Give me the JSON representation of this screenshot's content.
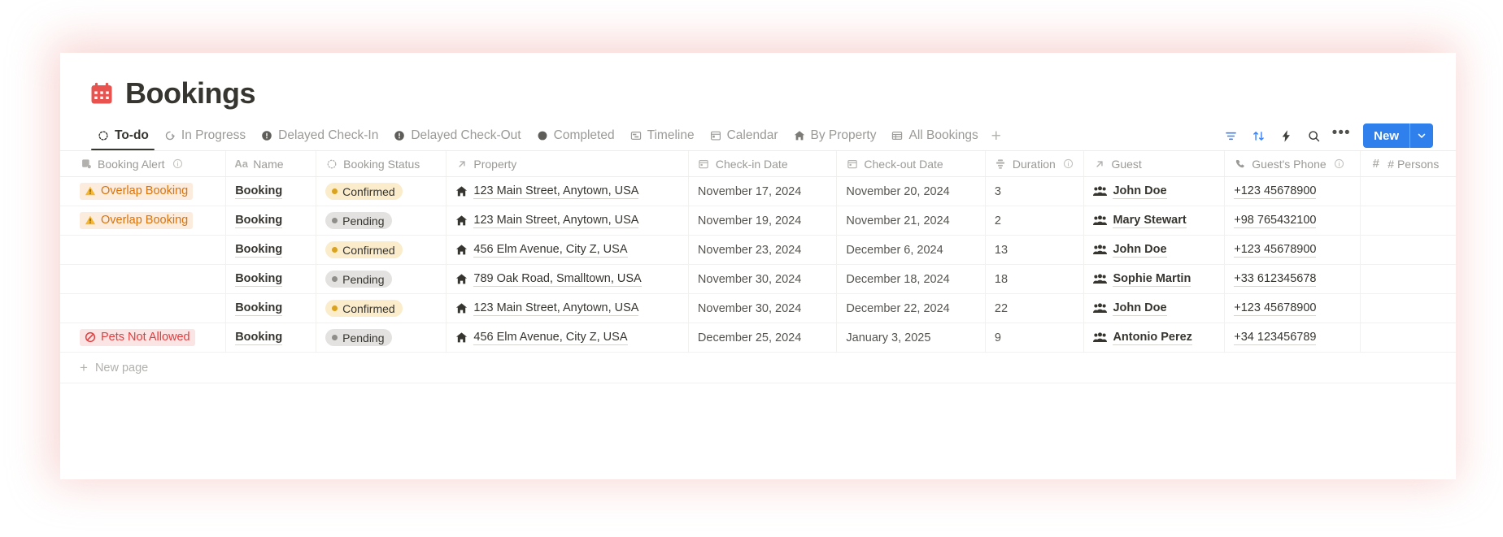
{
  "page": {
    "title": "Bookings",
    "icon": "calendar-icon"
  },
  "tabs": [
    {
      "label": "To-do",
      "icon": "dotted-circle-icon",
      "active": true
    },
    {
      "label": "In Progress",
      "icon": "progress-circle-icon",
      "active": false
    },
    {
      "label": "Delayed Check-In",
      "icon": "exclamation-circle-icon",
      "active": false
    },
    {
      "label": "Delayed Check-Out",
      "icon": "exclamation-circle-icon",
      "active": false
    },
    {
      "label": "Completed",
      "icon": "filled-circle-icon",
      "active": false
    },
    {
      "label": "Timeline",
      "icon": "timeline-icon",
      "active": false
    },
    {
      "label": "Calendar",
      "icon": "calendar-view-icon",
      "active": false
    },
    {
      "label": "By Property",
      "icon": "house-icon",
      "active": false
    },
    {
      "label": "All Bookings",
      "icon": "table-icon",
      "active": false
    }
  ],
  "tab_add_label": "+",
  "toolbar": {
    "filter_icon": "filter-icon",
    "sort_icon": "sort-icon",
    "automation_icon": "lightning-icon",
    "search_icon": "search-icon",
    "more_icon": "ellipsis-icon",
    "new_label": "New",
    "new_chevron_icon": "chevron-down-icon"
  },
  "table": {
    "columns": [
      {
        "label": "Booking Alert",
        "icon": "sticker-icon",
        "info": true,
        "key": "alert"
      },
      {
        "label": "Name",
        "icon": "title-aa-icon",
        "info": false,
        "key": "name"
      },
      {
        "label": "Booking Status",
        "icon": "loading-status-icon",
        "info": false,
        "key": "status"
      },
      {
        "label": "Property",
        "icon": "relation-arrow-icon",
        "info": false,
        "key": "property"
      },
      {
        "label": "Check-in Date",
        "icon": "date-icon",
        "info": false,
        "key": "checkin"
      },
      {
        "label": "Check-out Date",
        "icon": "date-icon",
        "info": false,
        "key": "checkout"
      },
      {
        "label": "Duration",
        "icon": "formula-icon",
        "info": true,
        "key": "duration"
      },
      {
        "label": "Guest",
        "icon": "relation-arrow-icon",
        "info": false,
        "key": "guest"
      },
      {
        "label": "Guest's Phone",
        "icon": "phone-icon",
        "info": true,
        "key": "phone"
      },
      {
        "label": "# Persons",
        "icon": "number-hash-icon",
        "info": false,
        "key": "persons"
      }
    ],
    "rows": [
      {
        "alert": "Overlap Booking",
        "alert_type": "overlap",
        "name": "Booking",
        "status": "Confirmed",
        "status_type": "confirmed",
        "property": "123 Main Street, Anytown, USA",
        "checkin": "November 17, 2024",
        "checkout": "November 20, 2024",
        "duration": "3",
        "guest": "John Doe",
        "phone": "+123 45678900",
        "persons": ""
      },
      {
        "alert": "Overlap Booking",
        "alert_type": "overlap",
        "name": "Booking",
        "status": "Pending",
        "status_type": "pending",
        "property": "123 Main Street, Anytown, USA",
        "checkin": "November 19, 2024",
        "checkout": "November 21, 2024",
        "duration": "2",
        "guest": "Mary Stewart",
        "phone": "+98 765432100",
        "persons": ""
      },
      {
        "alert": "",
        "alert_type": "none",
        "name": "Booking",
        "status": "Confirmed",
        "status_type": "confirmed",
        "property": "456 Elm Avenue, City Z, USA",
        "checkin": "November 23, 2024",
        "checkout": "December 6, 2024",
        "duration": "13",
        "guest": "John Doe",
        "phone": "+123 45678900",
        "persons": ""
      },
      {
        "alert": "",
        "alert_type": "none",
        "name": "Booking",
        "status": "Pending",
        "status_type": "pending",
        "property": "789 Oak Road, Smalltown, USA",
        "checkin": "November 30, 2024",
        "checkout": "December 18, 2024",
        "duration": "18",
        "guest": "Sophie Martin",
        "phone": "+33 612345678",
        "persons": ""
      },
      {
        "alert": "",
        "alert_type": "none",
        "name": "Booking",
        "status": "Confirmed",
        "status_type": "confirmed",
        "property": "123 Main Street, Anytown, USA",
        "checkin": "November 30, 2024",
        "checkout": "December 22, 2024",
        "duration": "22",
        "guest": "John Doe",
        "phone": "+123 45678900",
        "persons": ""
      },
      {
        "alert": "Pets Not Allowed",
        "alert_type": "pets",
        "name": "Booking",
        "status": "Pending",
        "status_type": "pending",
        "property": "456 Elm Avenue, City Z, USA",
        "checkin": "December 25, 2024",
        "checkout": "January 3, 2025",
        "duration": "9",
        "guest": "Antonio Perez",
        "phone": "+34 123456789",
        "persons": ""
      }
    ],
    "footer": {
      "label": "New page",
      "icon": "plus-icon"
    }
  },
  "colors": {
    "accent_blue": "#2f80ed",
    "glow_pink": "#f2b5b0",
    "alert_overlap_bg": "#fbecdd",
    "alert_overlap_fg": "#d9730d",
    "alert_pets_bg": "#fbe4e4",
    "alert_pets_fg": "#e03e3e",
    "badge_confirmed_bg": "#fbeccb",
    "badge_pending_bg": "#e3e2e0",
    "title_color": "#37352f"
  }
}
